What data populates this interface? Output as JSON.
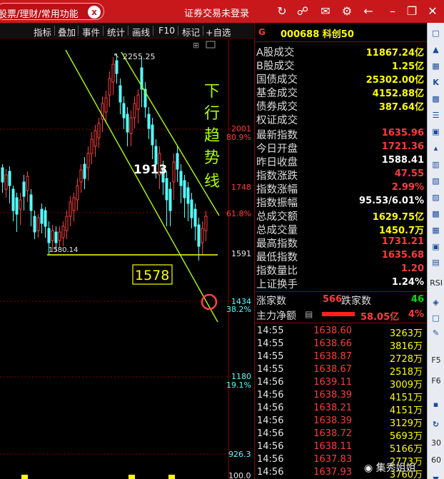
{
  "topbar": {
    "search_text": "股票/理财/常用功能",
    "notice": "证券交易未登录",
    "icons": [
      "refresh-icon",
      "shirt-icon",
      "message-icon",
      "gear-icon",
      "back-arrow-icon",
      "minimize-icon",
      "maximize-icon",
      "close-icon"
    ]
  },
  "chart_toolbar": [
    "指标",
    "叠加",
    "事件",
    "统计",
    "画线",
    "F10",
    "标记",
    "+自选"
  ],
  "chart": {
    "price_axis_labels": [
      {
        "price": "2001",
        "pct": "80.9%"
      },
      {
        "price": "1748",
        "pct": "61.8%"
      },
      {
        "price": "1591",
        "pct": ""
      },
      {
        "price": "1434",
        "pct": "38.2%"
      },
      {
        "price": "1180",
        "pct": "19.1%"
      },
      {
        "price": "926.3",
        "pct": ""
      },
      {
        "price": "100.0",
        "pct": ""
      }
    ],
    "high_label": "2255.25",
    "low_label": "1580.14",
    "annotation_1913": "1913",
    "annotation_1578": "1578",
    "trend_text": [
      "下",
      "行",
      "趋",
      "势",
      "线"
    ],
    "colors": {
      "up": "#ff3b3b",
      "down": "#54ffff",
      "trend": "#aaff00",
      "support": "#ffff00",
      "circle": "#ff4040"
    }
  },
  "info": {
    "flag": "G",
    "code_name": "000688 科创50",
    "rows": [
      {
        "label": "A股成交",
        "value": "11867.24亿",
        "color": "#ffff00"
      },
      {
        "label": "B股成交",
        "value": "1.25亿",
        "color": "#ffff00"
      },
      {
        "label": "国债成交",
        "value": "25302.00亿",
        "color": "#ffff00"
      },
      {
        "label": "基金成交",
        "value": "4152.88亿",
        "color": "#ffff00"
      },
      {
        "label": "债券成交",
        "value": "387.64亿",
        "color": "#ffff00"
      },
      {
        "label": "权证成交",
        "value": "",
        "color": "#ffff00"
      },
      {
        "label": "最新指数",
        "value": "1635.96",
        "color": "#ff3b3b"
      },
      {
        "label": "今日开盘",
        "value": "1721.36",
        "color": "#ff3b3b"
      },
      {
        "label": "昨日收盘",
        "value": "1588.41",
        "color": "#ffffff"
      },
      {
        "label": "指数涨跌",
        "value": "47.55",
        "color": "#ff3b3b"
      },
      {
        "label": "指数涨幅",
        "value": "2.99%",
        "color": "#ff3b3b"
      },
      {
        "label": "指数振幅",
        "value": "95.53/6.01%",
        "color": "#ffffff"
      },
      {
        "label": "总成交额",
        "value": "1629.75亿",
        "color": "#ffff00"
      },
      {
        "label": "总成交量",
        "value": "1450.7万",
        "color": "#ffff00"
      },
      {
        "label": "最高指数",
        "value": "1731.21",
        "color": "#ff3b3b"
      },
      {
        "label": "最低指数",
        "value": "1635.68",
        "color": "#ff3b3b"
      },
      {
        "label": "指数量比",
        "value": "1.20",
        "color": "#ff3b3b"
      },
      {
        "label": "上证换手",
        "value": "1.24%",
        "color": "#ffffff"
      }
    ],
    "up_label": "涨家数",
    "up_count": "566",
    "down_label": "跌家数",
    "down_count": "46",
    "flow_label": "主力净额",
    "flow_value": "58.05亿",
    "flow_pct": "4%"
  },
  "ticks": [
    {
      "time": "14:55",
      "price": "1638.60",
      "vol": "3263万"
    },
    {
      "time": "14:55",
      "price": "1638.66",
      "vol": "3816万"
    },
    {
      "time": "14:55",
      "price": "1638.87",
      "vol": "2728万"
    },
    {
      "time": "14:55",
      "price": "1638.67",
      "vol": "2518万"
    },
    {
      "time": "14:56",
      "price": "1639.11",
      "vol": "3009万"
    },
    {
      "time": "14:56",
      "price": "1638.39",
      "vol": "4151万"
    },
    {
      "time": "14:56",
      "price": "1638.21",
      "vol": "4151万"
    },
    {
      "time": "14:56",
      "price": "1638.39",
      "vol": "3129万"
    },
    {
      "time": "14:56",
      "price": "1638.72",
      "vol": "5693万"
    },
    {
      "time": "14:56",
      "price": "1638.11",
      "vol": "5166万"
    },
    {
      "time": "14:56",
      "price": "1637.83",
      "vol": "2773万"
    },
    {
      "time": "14:56",
      "price": "1637.93",
      "vol": "3760万"
    }
  ],
  "right_column": {
    "labels": [
      "RSI",
      "F5",
      "F6",
      "30",
      "60"
    ],
    "icons": [
      "square-icon",
      "up-icon",
      "grid-icon",
      "k-icon",
      "bar-icon",
      "list-icon",
      "table-icon",
      "chart-icon",
      "pencil-icon"
    ]
  },
  "watermark": "集秀姐姐"
}
